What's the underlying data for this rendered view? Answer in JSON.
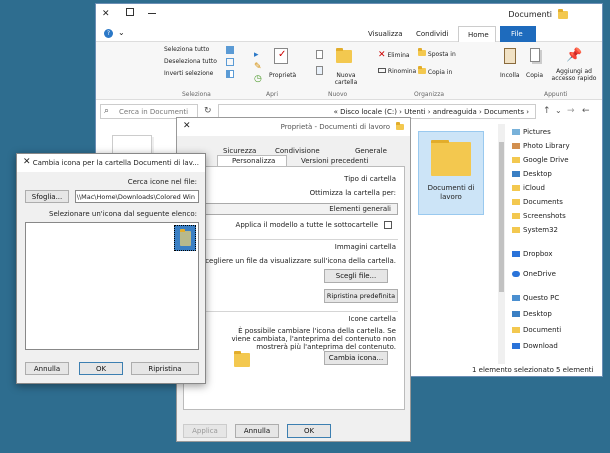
{
  "explorer": {
    "title": "Documenti",
    "tabs": [
      "File",
      "Home",
      "Condividi",
      "Visualizza"
    ],
    "groups": [
      "Appunti",
      "Organizza",
      "Nuovo",
      "Apri",
      "Seleziona"
    ],
    "ribbon": {
      "pin": "Aggiungi ad accesso rapido",
      "copy": "Copia",
      "paste": "Incolla",
      "move": "Sposta in",
      "copy_to": "Copia in",
      "delete": "Elimina",
      "rename": "Rinomina",
      "new_folder": "Nuova cartella",
      "properties": "Proprietà",
      "select_all": "Seleziona tutto",
      "deselect_all": "Deseleziona tutto",
      "invert": "Inverti selezione"
    },
    "breadcrumb": "« Disco locale (C:) › Utenti › andreaguida › Documents ›",
    "search_placeholder": "Cerca in Documenti",
    "nav": [
      "Pictures",
      "Photo Library",
      "Google Drive",
      "Desktop",
      "iCloud",
      "Documents",
      "Screenshots",
      "System32",
      "Dropbox",
      "OneDrive",
      "Questo PC",
      "Desktop",
      "Documenti",
      "Download"
    ],
    "folder_caption": "Documenti di lavoro",
    "status_left": "5 elementi",
    "status_right": "1 elemento selezionato"
  },
  "properties": {
    "title": "Proprietà - Documenti di lavoro",
    "tabs_row1": [
      "Generale",
      "Condivisione",
      "Sicurezza"
    ],
    "tabs_row2": [
      "Versioni precedenti",
      "Personalizza"
    ],
    "sec1_title": "Tipo di cartella",
    "sec1_label": "Ottimizza la cartella per:",
    "sec1_select": "Elementi generali",
    "sec1_check": "Applica il modello a tutte le sottocartelle",
    "sec2_title": "Immagini cartella",
    "sec2_desc": "Scegliere un file da visualizzare sull'icona della cartella.",
    "sec2_btn1": "Scegli file...",
    "sec2_btn2": "Ripristina predefinita",
    "sec3_title": "Icone cartella",
    "sec3_desc": "È possibile cambiare l'icona della cartella. Se viene cambiata, l'anteprima del contenuto non mostrerà più l'anteprima del contenuto.",
    "sec3_btn": "Cambia icona...",
    "ok": "OK",
    "cancel": "Annulla",
    "apply": "Applica"
  },
  "icon_dialog": {
    "title": "Cambia icona per la cartella Documenti di lav...",
    "close": "✕",
    "search_label": "Cerca icone nel file:",
    "path_value": "\\\\Mac\\Home\\Downloads\\Colored Win",
    "browse": "Sfoglia...",
    "list_label": "Selezionare un'icona dal seguente elenco:",
    "restore": "Ripristina",
    "ok": "OK",
    "cancel": "Annulla"
  }
}
